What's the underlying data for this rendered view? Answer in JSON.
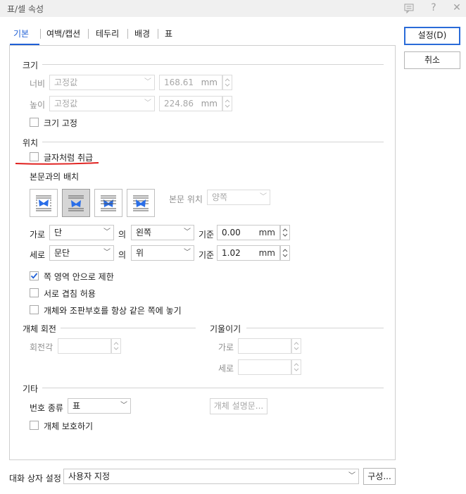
{
  "window": {
    "title": "표/셀 속성"
  },
  "tabs": [
    "기본",
    "여백/캡션",
    "테두리",
    "배경",
    "표"
  ],
  "buttons": {
    "ok": "설정(D)",
    "cancel": "취소"
  },
  "size": {
    "title": "크기",
    "width_label": "너비",
    "width_mode": "고정값",
    "width_value": "168.61",
    "width_unit": "mm",
    "height_label": "높이",
    "height_mode": "고정값",
    "height_value": "224.86",
    "height_unit": "mm",
    "fix_label": "크기 고정"
  },
  "position": {
    "title": "위치",
    "treat_as_char": "글자처럼 취급",
    "wrap_title": "본문과의 배치",
    "body_pos_label": "본문 위치",
    "body_pos_value": "양쪽",
    "h_label": "가로",
    "h_ref": "단",
    "h_of": "의",
    "h_align": "왼쪽",
    "h_base_label": "기준",
    "h_value": "0.00",
    "h_unit": "mm",
    "v_label": "세로",
    "v_ref": "문단",
    "v_of": "의",
    "v_align": "위",
    "v_base_label": "기준",
    "v_value": "1.02",
    "v_unit": "mm",
    "opt_limit": "쪽 영역 안으로 제한",
    "opt_overlap": "서로 겹침 허용",
    "opt_same_page": "개체와 조판부호를 항상 같은 쪽에 놓기",
    "limit_checked": true
  },
  "rotation": {
    "title": "개체 회전",
    "angle_label": "회전각"
  },
  "skew": {
    "title": "기울이기",
    "h_label": "가로",
    "v_label": "세로"
  },
  "other": {
    "title": "기타",
    "number_label": "번호 종류",
    "number_value": "표",
    "desc_button": "개체 설명문...",
    "protect_label": "개체 보호하기"
  },
  "footer": {
    "dialog_label": "대화 상자 설정",
    "dialog_value": "사용자 지정",
    "config_button": "구성..."
  },
  "colors": {
    "accent": "#1f5fd6",
    "annotation": "#e0211f",
    "butterfly": "#2a6ee8"
  }
}
